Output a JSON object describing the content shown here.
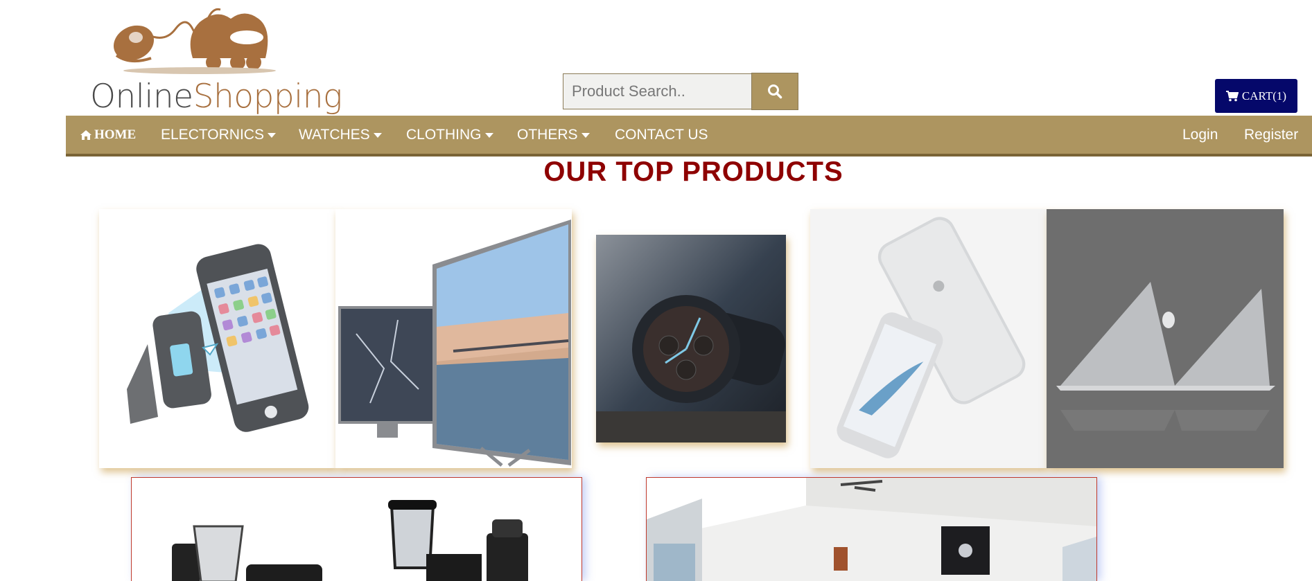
{
  "logo": {
    "word1": "Online",
    "word2": "Shopping"
  },
  "search": {
    "placeholder": "Product Search.."
  },
  "cart": {
    "label": "CART(1)"
  },
  "nav": {
    "home": "HOME",
    "items": [
      {
        "label": "ELECTORNICS",
        "dropdown": true
      },
      {
        "label": "WATCHES",
        "dropdown": true
      },
      {
        "label": "CLOTHING",
        "dropdown": true
      },
      {
        "label": "OTHERS",
        "dropdown": true
      },
      {
        "label": "CONTACT US",
        "dropdown": false
      }
    ],
    "login": "Login",
    "register": "Register"
  },
  "section": {
    "title": "OUR TOP PRODUCTS"
  },
  "products": [
    {
      "name": "phone-car-mount"
    },
    {
      "name": "television"
    },
    {
      "name": "wristwatch"
    },
    {
      "name": "iphone"
    },
    {
      "name": "macbook"
    }
  ],
  "promos": [
    {
      "name": "kitchen-appliances"
    },
    {
      "name": "interior-room"
    }
  ],
  "colors": {
    "navbar": "#ad9560",
    "cart_button": "#05086a",
    "title": "#8e0000",
    "logo_brown": "#a8703f"
  }
}
